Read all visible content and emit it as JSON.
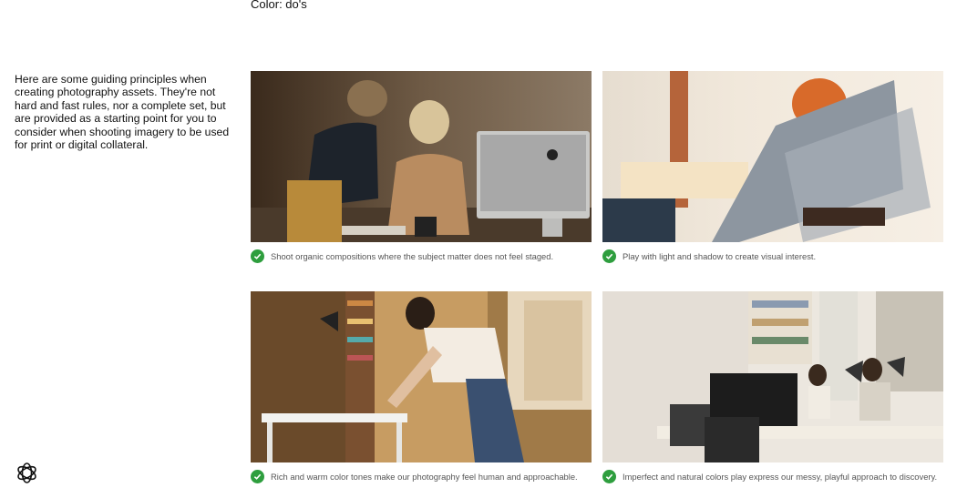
{
  "section": {
    "title": "Color: do's"
  },
  "intro": {
    "text": "Here are some guiding principles when creating photography assets. They're not hard and fast rules, nor a complete set, but are provided as a starting point for you to consider when shooting imagery to be used for print or digital collateral."
  },
  "cards": [
    {
      "caption": "Shoot organic compositions where the subject matter does not feel staged.",
      "icon": "check-circle-icon"
    },
    {
      "caption": "Play with light and shadow to create visual interest.",
      "icon": "check-circle-icon"
    },
    {
      "caption": "Rich and warm color tones make our photography feel human and approachable.",
      "icon": "check-circle-icon"
    },
    {
      "caption": "Imperfect and natural colors play express our messy, playful approach to discovery.",
      "icon": "check-circle-icon"
    }
  ],
  "colors": {
    "check": "#2e9e3e",
    "caption_text": "#555555"
  },
  "logo": {
    "icon": "openai-logo-icon"
  }
}
